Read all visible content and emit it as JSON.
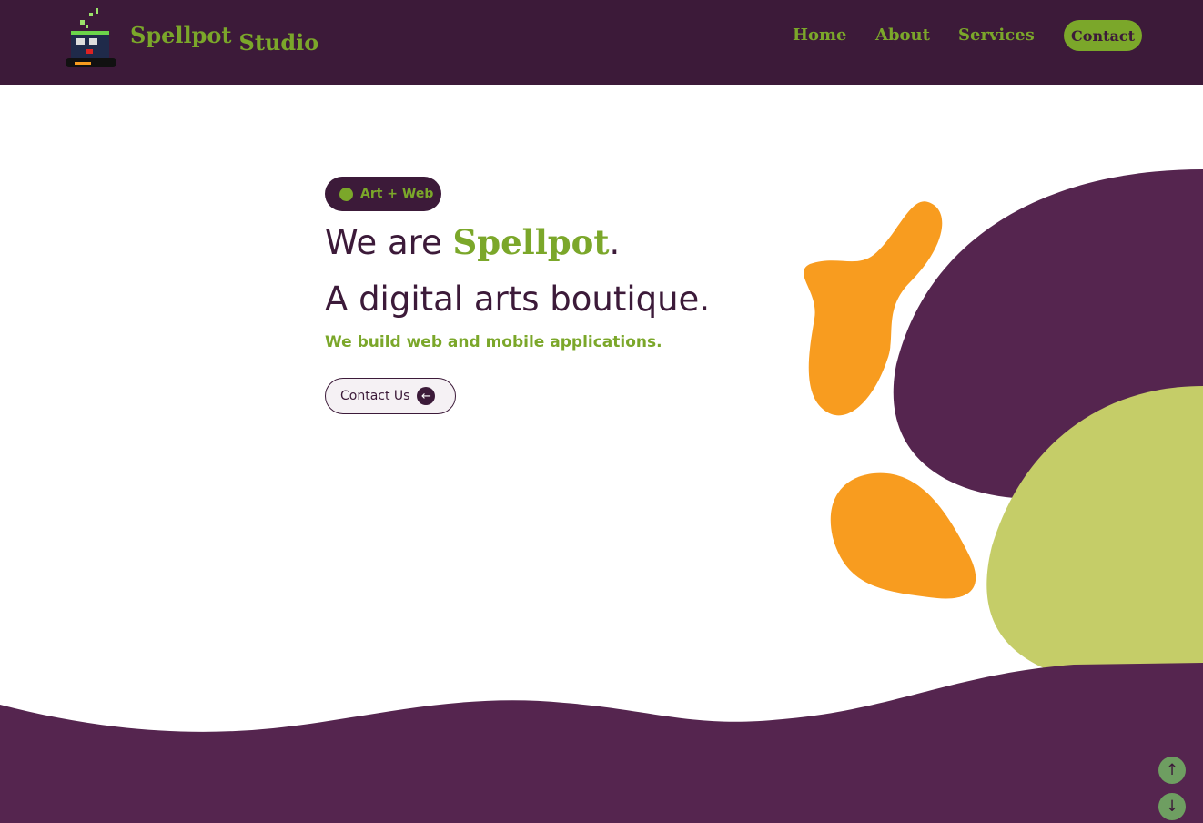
{
  "header": {
    "brand_word1": "Spellpot",
    "brand_word2": "Studio",
    "nav": [
      "Home",
      "About",
      "Services"
    ],
    "contact": "Contact"
  },
  "hero": {
    "badge": "Art + Web",
    "line1_prefix": "We are ",
    "line1_brand": "Spellpot",
    "line1_suffix": ".",
    "line2": "A digital arts boutique.",
    "subtitle": "We build web and mobile applications.",
    "cta": "Contact Us",
    "cta_icon": "←"
  },
  "scroll": {
    "up": "↑",
    "down": "↓"
  },
  "colors": {
    "purple": "#3c1a39",
    "green": "#7ba72a",
    "orange": "#f89c1f",
    "lime": "#c5cd68",
    "plum": "#55254f"
  }
}
